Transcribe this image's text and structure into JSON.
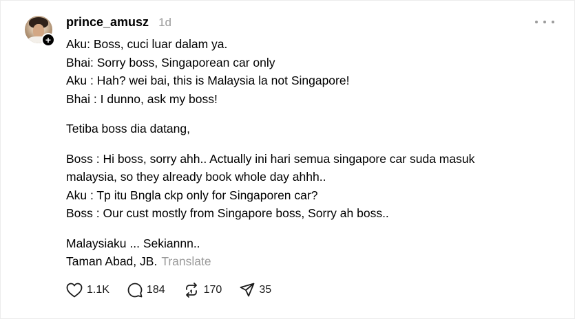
{
  "post": {
    "username": "prince_amusz",
    "time": "1d",
    "follow_symbol": "+",
    "lines": [
      "Aku: Boss, cuci luar dalam ya.",
      "Bhai: Sorry boss, Singaporean car only",
      "Aku : Hah? wei bai, this is Malaysia la not Singapore!",
      "Bhai : I dunno, ask my boss!",
      "Tetiba boss dia datang,",
      "Boss : Hi boss, sorry ahh.. Actually ini hari semua singapore car suda masuk",
      "malaysia, so they already book whole day ahhh..",
      "Aku : Tp itu Bngla ckp only for Singaporen car?",
      "Boss : Our cust mostly from Singapore boss, Sorry ah boss..",
      "Malaysiaku ... Sekiannn..",
      "Taman Abad, JB."
    ],
    "translate_label": "Translate"
  },
  "actions": {
    "likes": "1.1K",
    "comments": "184",
    "reposts": "170",
    "shares": "35"
  },
  "icons": {
    "like": "heart-icon",
    "comment": "comment-icon",
    "repost": "repost-icon",
    "share": "share-icon",
    "more": "more-icon"
  },
  "colors": {
    "text": "#000000",
    "muted": "#9a9a9a",
    "background": "#ffffff"
  }
}
